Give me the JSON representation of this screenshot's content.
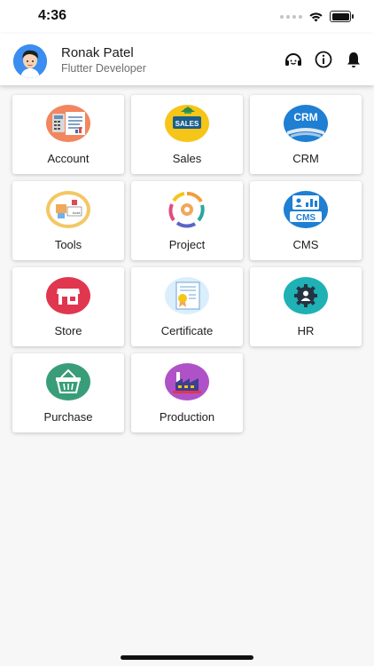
{
  "status_bar": {
    "time": "4:36"
  },
  "header": {
    "user_name": "Ronak Patel",
    "user_role": "Flutter Developer",
    "actions": [
      "support-icon",
      "info-icon",
      "bell-icon"
    ]
  },
  "modules": [
    {
      "label": "Account",
      "icon": "account-icon"
    },
    {
      "label": "Sales",
      "icon": "sales-icon",
      "badge_text": "SALES"
    },
    {
      "label": "CRM",
      "icon": "crm-icon",
      "badge_text": "CRM"
    },
    {
      "label": "Tools",
      "icon": "tools-icon"
    },
    {
      "label": "Project",
      "icon": "project-icon"
    },
    {
      "label": "CMS",
      "icon": "cms-icon",
      "badge_text": "CMS"
    },
    {
      "label": "Store",
      "icon": "store-icon"
    },
    {
      "label": "Certificate",
      "icon": "certificate-icon"
    },
    {
      "label": "HR",
      "icon": "hr-icon"
    },
    {
      "label": "Purchase",
      "icon": "purchase-icon"
    },
    {
      "label": "Production",
      "icon": "production-icon"
    }
  ],
  "colors": {
    "background": "#f7f7f7",
    "tile": "#ffffff",
    "avatar": "#3b8df0",
    "crm": "#1e7fd3",
    "store": "#e0364f",
    "hr": "#1fb1b4",
    "purchase": "#3a9d7a",
    "production": "#b052c7"
  }
}
